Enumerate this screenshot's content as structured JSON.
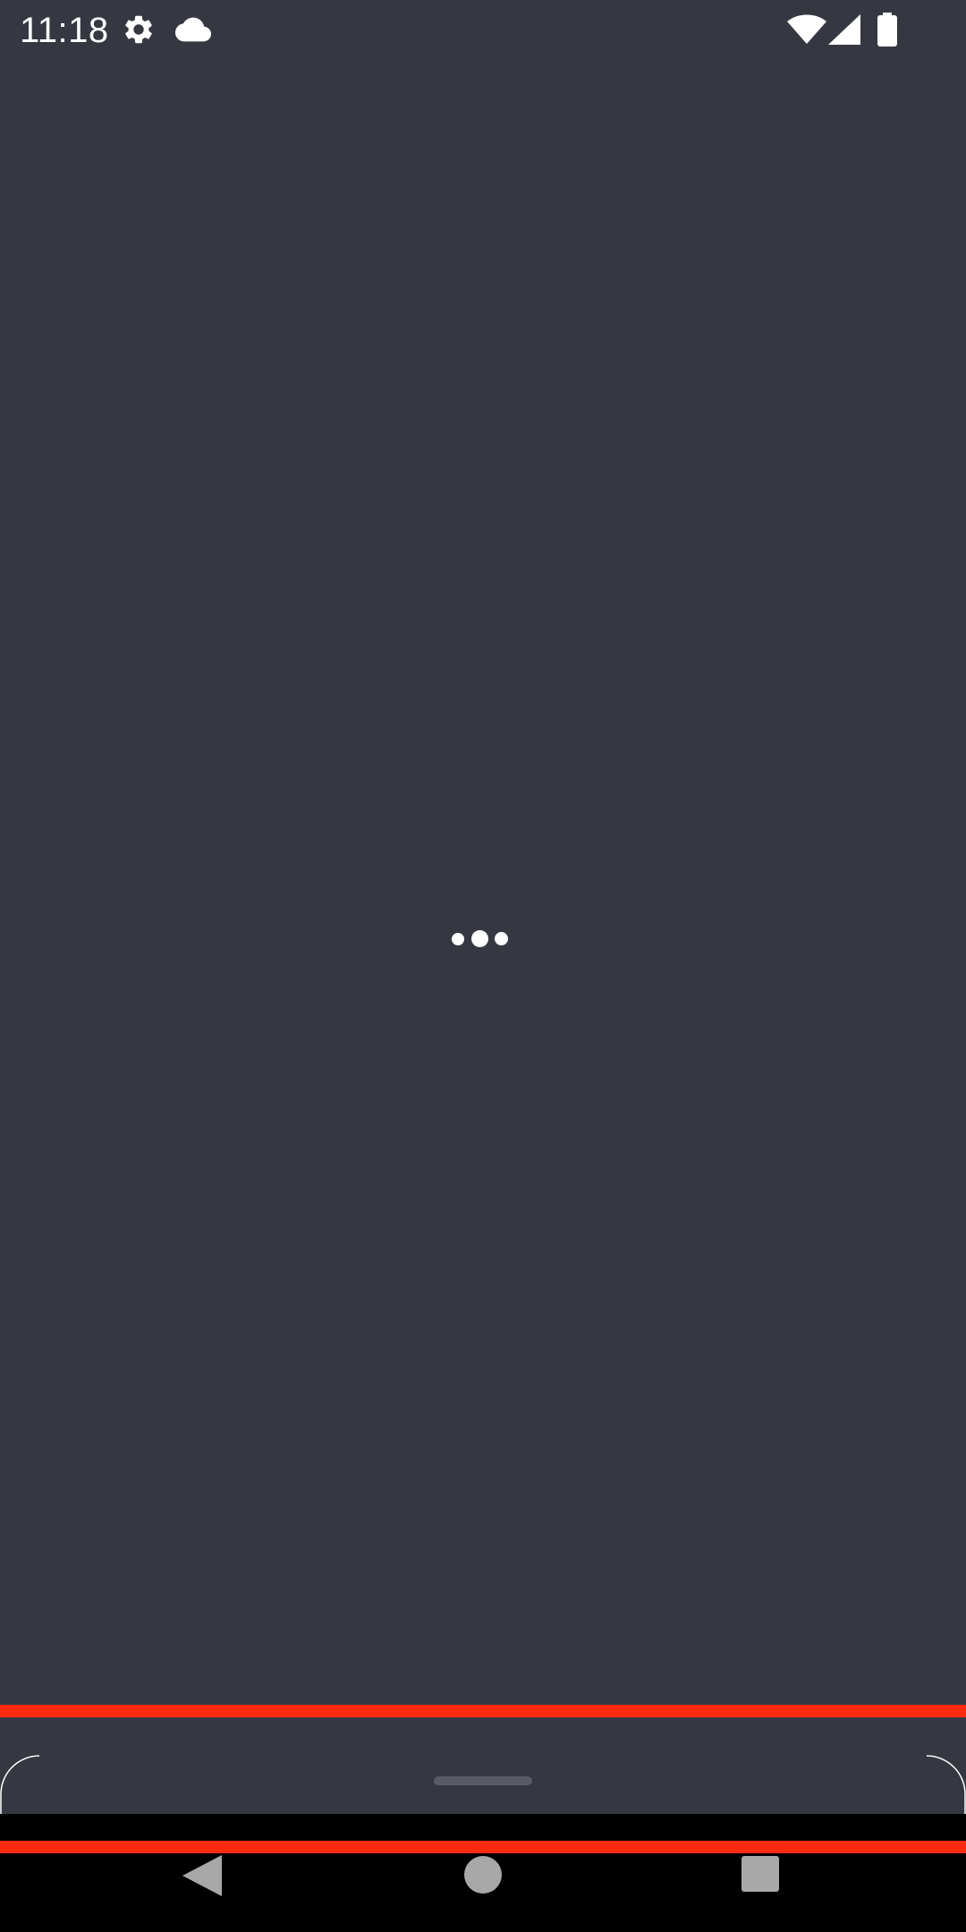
{
  "status_bar": {
    "time": "11:18",
    "left_icons": [
      "gear-icon",
      "cloud-icon"
    ],
    "right_icons": [
      "wifi-icon",
      "signal-icon",
      "battery-icon"
    ]
  },
  "content": {
    "loading_indicator": "three-dot-loader"
  },
  "overlay": {
    "line_color": "#ff2a10"
  },
  "navigation": {
    "buttons": [
      "back",
      "home",
      "recents"
    ]
  },
  "colors": {
    "background": "#363841",
    "nav_background": "#000000",
    "accent_line": "#ff2a10"
  }
}
